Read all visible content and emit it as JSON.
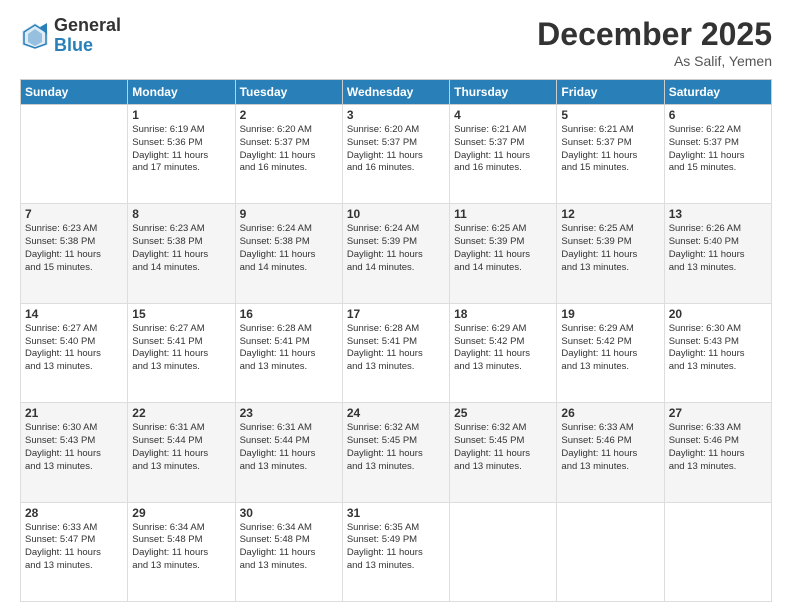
{
  "logo": {
    "general": "General",
    "blue": "Blue"
  },
  "title": "December 2025",
  "location": "As Salif, Yemen",
  "weekdays": [
    "Sunday",
    "Monday",
    "Tuesday",
    "Wednesday",
    "Thursday",
    "Friday",
    "Saturday"
  ],
  "weeks": [
    [
      {
        "day": "",
        "info": ""
      },
      {
        "day": "1",
        "info": "Sunrise: 6:19 AM\nSunset: 5:36 PM\nDaylight: 11 hours\nand 17 minutes."
      },
      {
        "day": "2",
        "info": "Sunrise: 6:20 AM\nSunset: 5:37 PM\nDaylight: 11 hours\nand 16 minutes."
      },
      {
        "day": "3",
        "info": "Sunrise: 6:20 AM\nSunset: 5:37 PM\nDaylight: 11 hours\nand 16 minutes."
      },
      {
        "day": "4",
        "info": "Sunrise: 6:21 AM\nSunset: 5:37 PM\nDaylight: 11 hours\nand 16 minutes."
      },
      {
        "day": "5",
        "info": "Sunrise: 6:21 AM\nSunset: 5:37 PM\nDaylight: 11 hours\nand 15 minutes."
      },
      {
        "day": "6",
        "info": "Sunrise: 6:22 AM\nSunset: 5:37 PM\nDaylight: 11 hours\nand 15 minutes."
      }
    ],
    [
      {
        "day": "7",
        "info": "Sunrise: 6:23 AM\nSunset: 5:38 PM\nDaylight: 11 hours\nand 15 minutes."
      },
      {
        "day": "8",
        "info": "Sunrise: 6:23 AM\nSunset: 5:38 PM\nDaylight: 11 hours\nand 14 minutes."
      },
      {
        "day": "9",
        "info": "Sunrise: 6:24 AM\nSunset: 5:38 PM\nDaylight: 11 hours\nand 14 minutes."
      },
      {
        "day": "10",
        "info": "Sunrise: 6:24 AM\nSunset: 5:39 PM\nDaylight: 11 hours\nand 14 minutes."
      },
      {
        "day": "11",
        "info": "Sunrise: 6:25 AM\nSunset: 5:39 PM\nDaylight: 11 hours\nand 14 minutes."
      },
      {
        "day": "12",
        "info": "Sunrise: 6:25 AM\nSunset: 5:39 PM\nDaylight: 11 hours\nand 13 minutes."
      },
      {
        "day": "13",
        "info": "Sunrise: 6:26 AM\nSunset: 5:40 PM\nDaylight: 11 hours\nand 13 minutes."
      }
    ],
    [
      {
        "day": "14",
        "info": "Sunrise: 6:27 AM\nSunset: 5:40 PM\nDaylight: 11 hours\nand 13 minutes."
      },
      {
        "day": "15",
        "info": "Sunrise: 6:27 AM\nSunset: 5:41 PM\nDaylight: 11 hours\nand 13 minutes."
      },
      {
        "day": "16",
        "info": "Sunrise: 6:28 AM\nSunset: 5:41 PM\nDaylight: 11 hours\nand 13 minutes."
      },
      {
        "day": "17",
        "info": "Sunrise: 6:28 AM\nSunset: 5:41 PM\nDaylight: 11 hours\nand 13 minutes."
      },
      {
        "day": "18",
        "info": "Sunrise: 6:29 AM\nSunset: 5:42 PM\nDaylight: 11 hours\nand 13 minutes."
      },
      {
        "day": "19",
        "info": "Sunrise: 6:29 AM\nSunset: 5:42 PM\nDaylight: 11 hours\nand 13 minutes."
      },
      {
        "day": "20",
        "info": "Sunrise: 6:30 AM\nSunset: 5:43 PM\nDaylight: 11 hours\nand 13 minutes."
      }
    ],
    [
      {
        "day": "21",
        "info": "Sunrise: 6:30 AM\nSunset: 5:43 PM\nDaylight: 11 hours\nand 13 minutes."
      },
      {
        "day": "22",
        "info": "Sunrise: 6:31 AM\nSunset: 5:44 PM\nDaylight: 11 hours\nand 13 minutes."
      },
      {
        "day": "23",
        "info": "Sunrise: 6:31 AM\nSunset: 5:44 PM\nDaylight: 11 hours\nand 13 minutes."
      },
      {
        "day": "24",
        "info": "Sunrise: 6:32 AM\nSunset: 5:45 PM\nDaylight: 11 hours\nand 13 minutes."
      },
      {
        "day": "25",
        "info": "Sunrise: 6:32 AM\nSunset: 5:45 PM\nDaylight: 11 hours\nand 13 minutes."
      },
      {
        "day": "26",
        "info": "Sunrise: 6:33 AM\nSunset: 5:46 PM\nDaylight: 11 hours\nand 13 minutes."
      },
      {
        "day": "27",
        "info": "Sunrise: 6:33 AM\nSunset: 5:46 PM\nDaylight: 11 hours\nand 13 minutes."
      }
    ],
    [
      {
        "day": "28",
        "info": "Sunrise: 6:33 AM\nSunset: 5:47 PM\nDaylight: 11 hours\nand 13 minutes."
      },
      {
        "day": "29",
        "info": "Sunrise: 6:34 AM\nSunset: 5:48 PM\nDaylight: 11 hours\nand 13 minutes."
      },
      {
        "day": "30",
        "info": "Sunrise: 6:34 AM\nSunset: 5:48 PM\nDaylight: 11 hours\nand 13 minutes."
      },
      {
        "day": "31",
        "info": "Sunrise: 6:35 AM\nSunset: 5:49 PM\nDaylight: 11 hours\nand 13 minutes."
      },
      {
        "day": "",
        "info": ""
      },
      {
        "day": "",
        "info": ""
      },
      {
        "day": "",
        "info": ""
      }
    ]
  ]
}
